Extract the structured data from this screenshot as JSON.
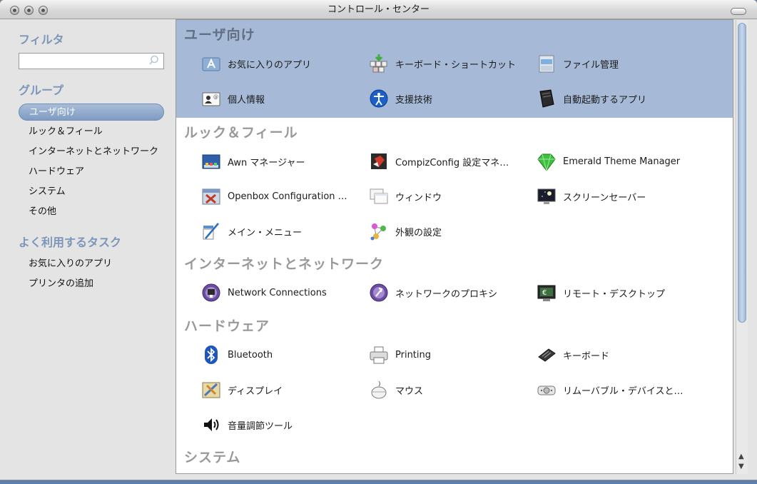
{
  "window": {
    "title": "コントロール・センター"
  },
  "sidebar": {
    "filter_heading": "フィルタ",
    "search_placeholder": "",
    "group_heading": "グループ",
    "groups": [
      "ユーザ向け",
      "ルック＆フィール",
      "インターネットとネットワーク",
      "ハードウェア",
      "システム",
      "その他"
    ],
    "tasks_heading": "よく利用するタスク",
    "tasks": [
      "お気に入りのアプリ",
      "プリンタの追加"
    ]
  },
  "main": {
    "categories": [
      {
        "name": "ユーザ向け",
        "items": [
          {
            "label": "お気に入りのアプリ",
            "icon": "app-store-icon"
          },
          {
            "label": "キーボード・ショートカット",
            "icon": "keyboard-shortcut-icon"
          },
          {
            "label": "ファイル管理",
            "icon": "file-cabinet-icon"
          },
          {
            "label": "個人情報",
            "icon": "personal-card-icon"
          },
          {
            "label": "支援技術",
            "icon": "accessibility-icon"
          },
          {
            "label": "自動起動するアプリ",
            "icon": "book-icon"
          }
        ]
      },
      {
        "name": "ルック＆フィール",
        "items": [
          {
            "label": "Awn マネージャー",
            "icon": "awn-dock-icon"
          },
          {
            "label": "CompizConfig 設定マネ…",
            "icon": "compiz-cube-icon"
          },
          {
            "label": "Emerald Theme Manager",
            "icon": "emerald-gem-icon"
          },
          {
            "label": "Openbox Configuration …",
            "icon": "tools-icon"
          },
          {
            "label": "ウィンドウ",
            "icon": "windows-icon"
          },
          {
            "label": "スクリーンセーバー",
            "icon": "screensaver-monitor-icon"
          },
          {
            "label": "メイン・メニュー",
            "icon": "menu-editor-icon"
          },
          {
            "label": "外観の設定",
            "icon": "appearance-molecule-icon"
          }
        ]
      },
      {
        "name": "インターネットとネットワーク",
        "items": [
          {
            "label": "Network Connections",
            "icon": "network-connections-icon"
          },
          {
            "label": "ネットワークのプロキシ",
            "icon": "network-proxy-icon"
          },
          {
            "label": "リモート・デスクトップ",
            "icon": "remote-desktop-icon"
          }
        ]
      },
      {
        "name": "ハードウェア",
        "items": [
          {
            "label": "Bluetooth",
            "icon": "bluetooth-icon"
          },
          {
            "label": "Printing",
            "icon": "printer-icon"
          },
          {
            "label": "キーボード",
            "icon": "keyboard-icon"
          },
          {
            "label": "ディスプレイ",
            "icon": "display-icon"
          },
          {
            "label": "マウス",
            "icon": "mouse-icon"
          },
          {
            "label": "リムーバブル・デバイスと…",
            "icon": "removable-drive-icon"
          },
          {
            "label": "音量調節ツール",
            "icon": "speaker-icon"
          }
        ]
      },
      {
        "name": "システム",
        "items": []
      }
    ]
  }
}
